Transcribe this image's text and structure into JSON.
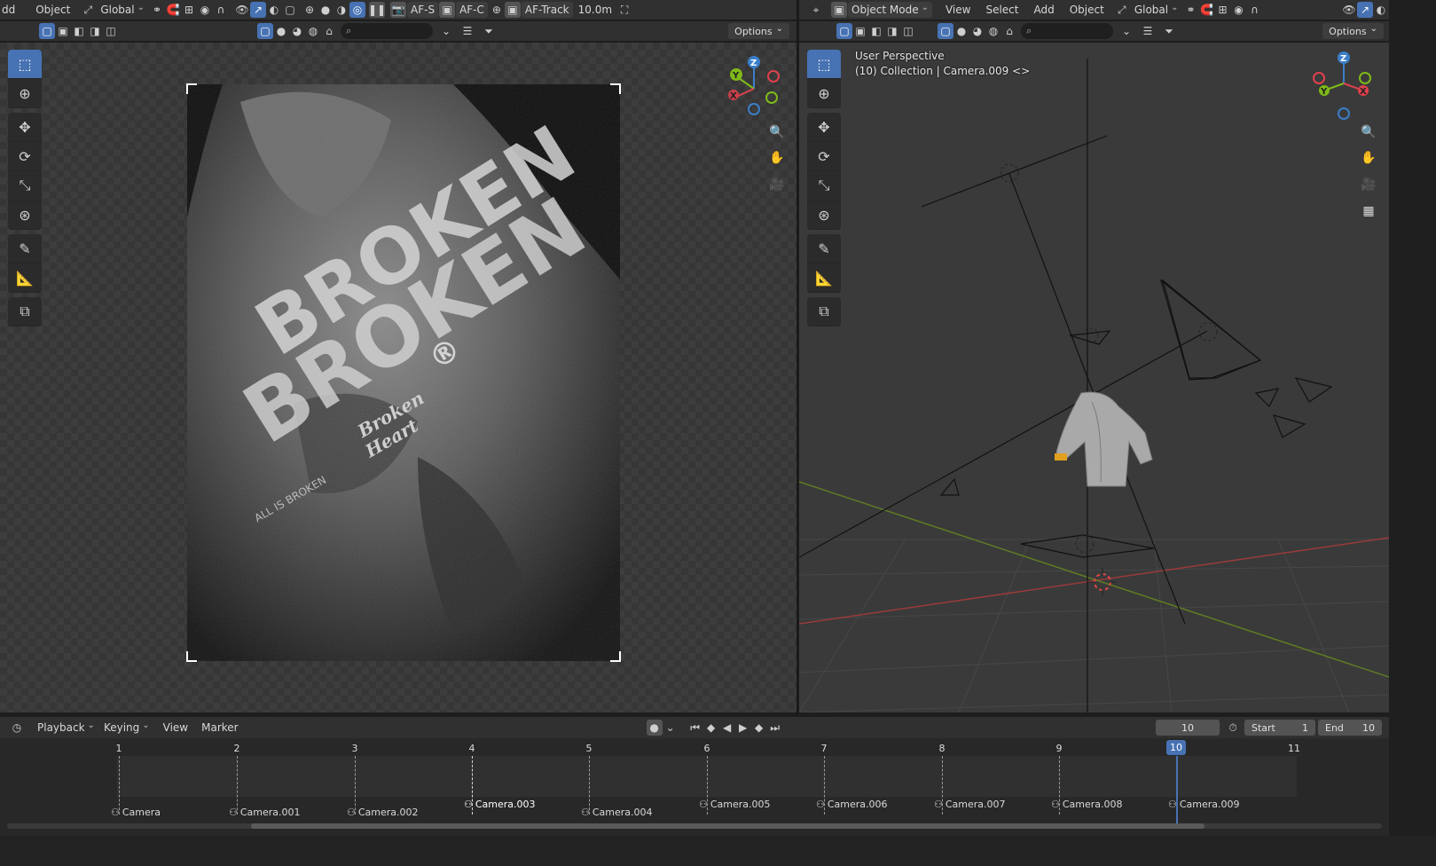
{
  "left_header": {
    "menus": [
      "dd",
      "Object"
    ],
    "orientation": "Global",
    "af_s": "AF-S",
    "af_c": "AF-C",
    "af_track": "AF-Track",
    "distance": "10.0m",
    "options": "Options"
  },
  "right_header": {
    "mode": "Object Mode",
    "menus": [
      "View",
      "Select",
      "Add",
      "Object"
    ],
    "orientation": "Global",
    "options": "Options"
  },
  "right_viewport": {
    "title": "User Perspective",
    "subtitle": "(10) Collection | Camera.009 <>"
  },
  "axes": {
    "x": "X",
    "y": "Y",
    "z": "Z"
  },
  "colors": {
    "accent": "#4772b3",
    "axis_x": "#e0404e",
    "axis_y": "#7fba19",
    "axis_z": "#3a7ec9",
    "header_bg": "#303030",
    "viewport_bg": "#3a3a3a"
  },
  "poster": {
    "headline_1": "BROKEN",
    "headline_2": "BROKEN",
    "registered": "®",
    "script_1": "Broken",
    "script_2": "Heart",
    "tagline": "ALL IS BROKEN"
  },
  "timeline_header": {
    "menus": [
      "Playback",
      "Keying",
      "View",
      "Marker"
    ],
    "current_frame": "10",
    "start_label": "Start",
    "start_value": "1",
    "end_label": "End",
    "end_value": "10"
  },
  "timeline": {
    "frames": [
      "1",
      "2",
      "3",
      "4",
      "5",
      "6",
      "7",
      "8",
      "9",
      "10",
      "11"
    ],
    "current": "10",
    "markers": [
      "Camera",
      "Camera.001",
      "Camera.002",
      "Camera.003",
      "Camera.004",
      "Camera.005",
      "Camera.006",
      "Camera.007",
      "Camera.008",
      "Camera.009"
    ]
  }
}
